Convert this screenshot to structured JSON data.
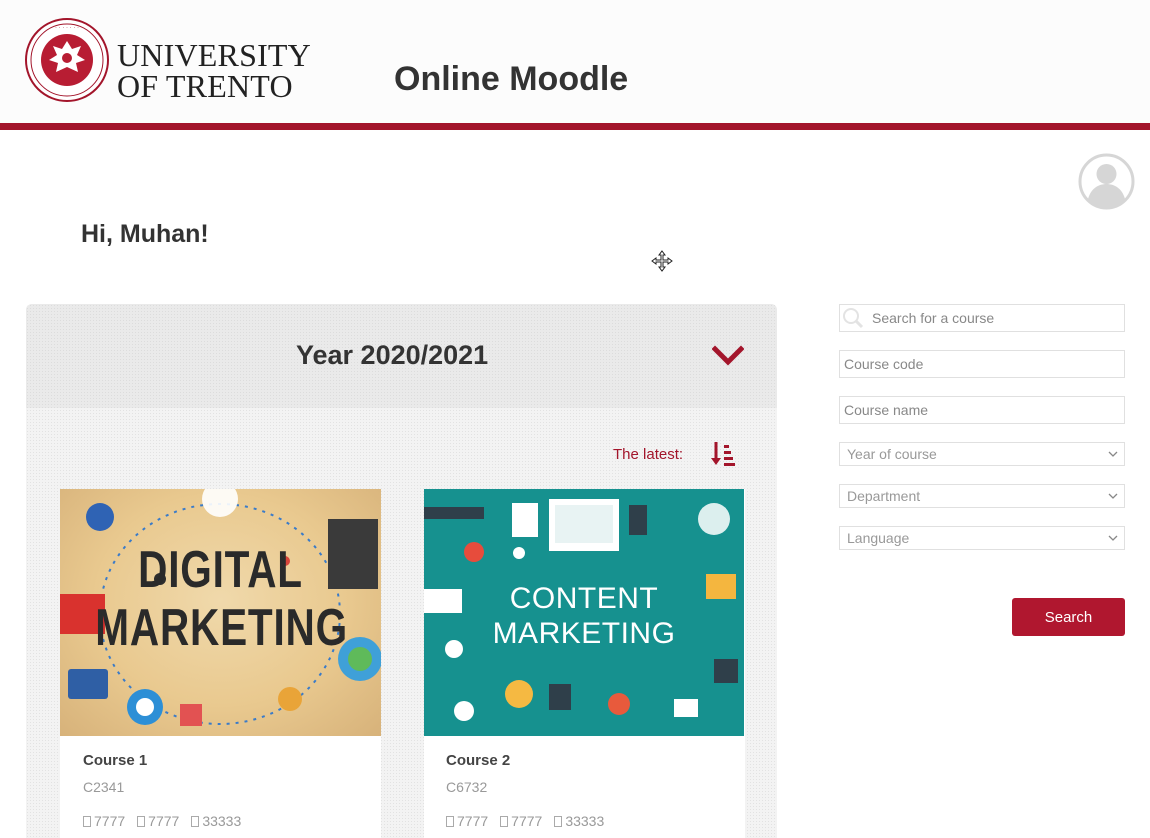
{
  "header": {
    "university_line1": "UNIVERSITY",
    "university_line2": "OF TRENTO",
    "app_title": "Online Moodle",
    "brand_color": "#a3152b"
  },
  "greeting": "Hi, Muhan!",
  "year_section": {
    "title": "Year 2020/2021",
    "sort_label": "The latest:"
  },
  "courses": [
    {
      "name": "Course 1",
      "code": "C2341",
      "image_text": [
        "DIGITAL",
        "MARKETING"
      ],
      "stats": [
        "7777",
        "7777",
        "33333"
      ]
    },
    {
      "name": "Course 2",
      "code": "C6732",
      "image_text": [
        "CONTENT",
        "MARKETING"
      ],
      "stats": [
        "7777",
        "7777",
        "33333"
      ]
    }
  ],
  "search_form": {
    "search_placeholder": "Search for a course",
    "code_placeholder": "Course code",
    "name_placeholder": "Course name",
    "year_select": "Year of course",
    "department_select": "Department",
    "language_select": "Language",
    "search_button": "Search"
  }
}
